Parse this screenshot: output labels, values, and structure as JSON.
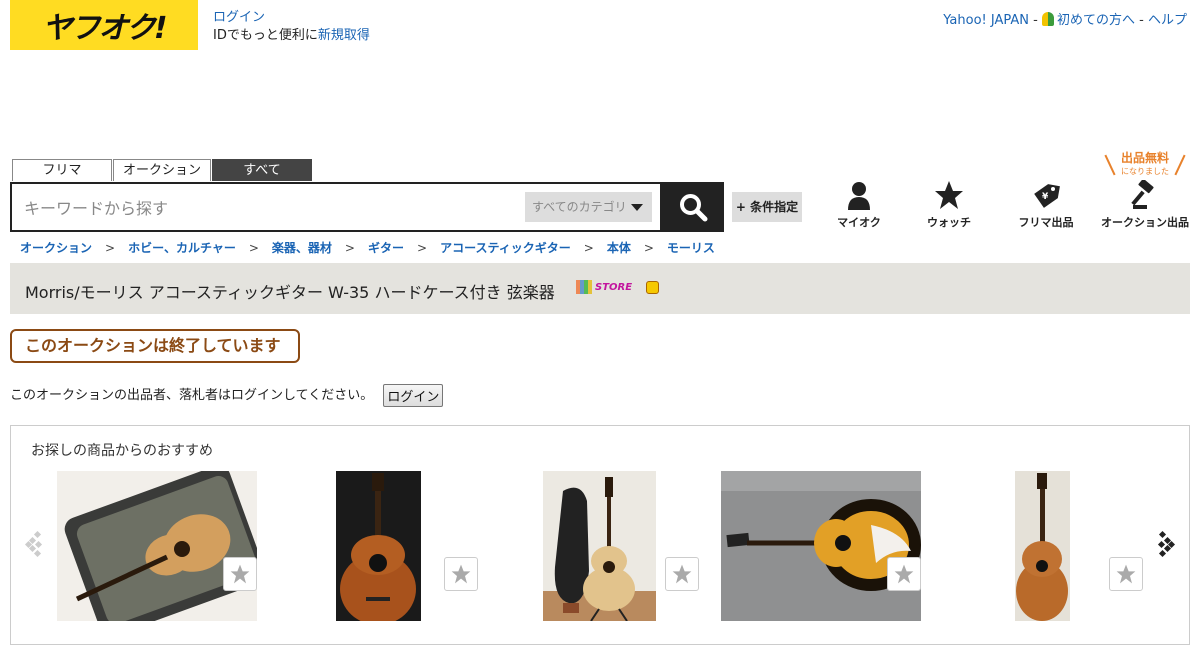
{
  "header": {
    "logo_text": "ヤフオク!",
    "login_link": "ログイン",
    "login_prompt": "IDでもっと便利に",
    "register_link": "新規取得",
    "links": {
      "yahoo_japan": "Yahoo! JAPAN",
      "beginners": "初めての方へ",
      "help": "ヘルプ",
      "separator": "-"
    }
  },
  "search": {
    "tabs": [
      "フリマ",
      "オークション",
      "すべて"
    ],
    "active_tab": "すべて",
    "placeholder": "キーワードから探す",
    "category_select": "すべてのカテゴリ",
    "condition_button": "+ 条件指定"
  },
  "nav": {
    "myauction": "マイオク",
    "watch": "ウォッチ",
    "flea_sell": "フリマ出品",
    "auction_sell": "オークション出品",
    "free_badge_title": "出品無料",
    "free_badge_sub": "になりました"
  },
  "breadcrumb": [
    "オークション",
    "ホビー、カルチャー",
    "楽器、器材",
    "ギター",
    "アコースティックギター",
    "本体",
    "モーリス"
  ],
  "item": {
    "title": "Morris/モーリス アコースティックギター W-35 ハードケース付き 弦楽器",
    "store_badge": "STORE"
  },
  "status": {
    "ended_label": "このオークションは終了しています",
    "login_notice": "このオークションの出品者、落札者はログインしてください。",
    "login_button": "ログイン"
  },
  "recommend": {
    "title": "お探しの商品からのおすすめ",
    "items": [
      {
        "image": "acoustic-guitar-in-case",
        "color": "#c89452"
      },
      {
        "image": "sunburst-acoustic-guitar",
        "color": "#7a3a12"
      },
      {
        "image": "natural-guitar-with-case",
        "color": "#d8b77c"
      },
      {
        "image": "sunburst-guitar-on-sofa",
        "color": "#e0a22a"
      },
      {
        "image": "natural-guitar-standing",
        "color": "#b86b2a"
      }
    ]
  },
  "colors": {
    "brand_yellow": "#ffdc22",
    "link_blue": "#1a64b4",
    "ended_brown": "#8b4a14",
    "free_orange": "#e8822c"
  }
}
